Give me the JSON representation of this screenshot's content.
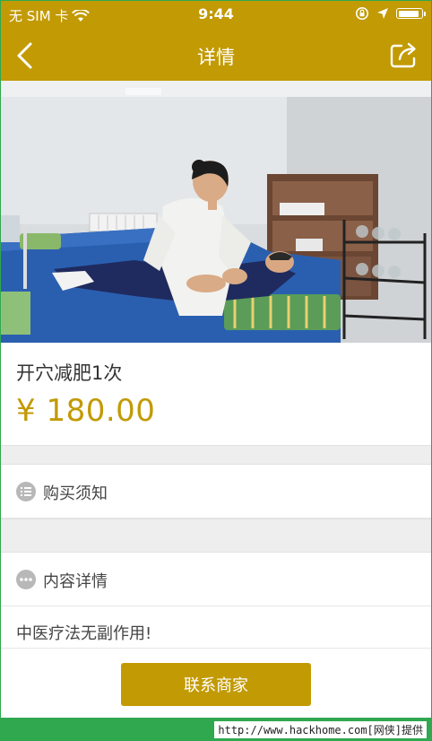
{
  "status_bar": {
    "carrier": "无 SIM 卡",
    "time": "9:44",
    "battery_level": 0.92
  },
  "nav": {
    "title": "详情"
  },
  "product": {
    "title": "开穴减肥1次",
    "price": "¥ 180.00"
  },
  "sections": {
    "purchase_notice": "购买须知",
    "content_details": "内容详情"
  },
  "description": {
    "text": "中医疗法无副作用!"
  },
  "actions": {
    "contact_label": "联系商家"
  },
  "watermark": {
    "text": "http://www.hackhome.com[网侠]提供"
  },
  "colors": {
    "brand": "#c29a04",
    "background": "#ffffff",
    "divider": "#eeeeee",
    "watermark_bar": "#2fa84f"
  },
  "icons": {
    "wifi": "wifi-icon",
    "rotation_lock": "rotation-lock-icon",
    "location": "location-arrow-icon",
    "battery": "battery-icon",
    "back": "chevron-left-icon",
    "share": "share-icon",
    "list": "list-icon",
    "more": "more-dots-icon"
  }
}
